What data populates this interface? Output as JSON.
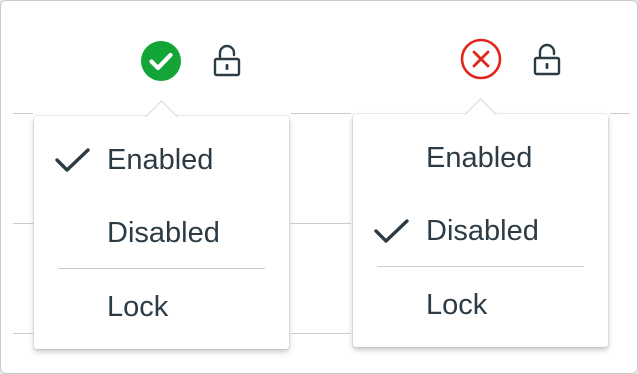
{
  "colors": {
    "enabled": "#13a538",
    "disabled": "#e0261b",
    "text": "#2d3b45",
    "divider": "#c7cdd1"
  },
  "left_panel": {
    "status_icon": "check-circle-icon",
    "lock_icon": "unlocked-padlock-icon",
    "menu": {
      "items": [
        {
          "label": "Enabled",
          "checked": true
        },
        {
          "label": "Disabled",
          "checked": false
        },
        {
          "label": "Lock",
          "checked": false
        }
      ]
    }
  },
  "right_panel": {
    "status_icon": "x-circle-icon",
    "lock_icon": "unlocked-padlock-icon",
    "menu": {
      "items": [
        {
          "label": "Enabled",
          "checked": false
        },
        {
          "label": "Disabled",
          "checked": true
        },
        {
          "label": "Lock",
          "checked": false
        }
      ]
    }
  }
}
